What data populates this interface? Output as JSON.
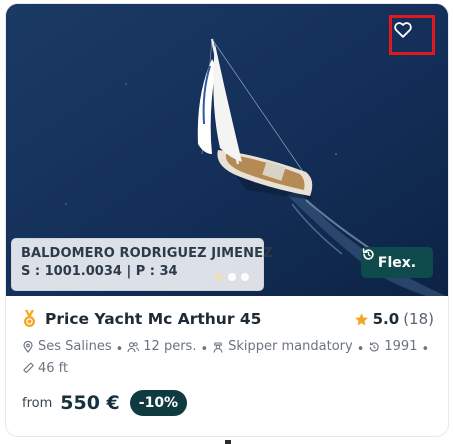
{
  "listing": {
    "owner_name": "BALDOMERO RODRIGUEZ JIMENEZ",
    "owner_meta": "S : 1001.0034 | P : 34",
    "flex_label": "Flex.",
    "title": "Price Yacht Mc Arthur 45",
    "rating_value": "5.0",
    "rating_count": "(18)",
    "specs": {
      "location": "Ses Salines",
      "capacity": "12 pers.",
      "skipper": "Skipper mandatory",
      "year": "1991",
      "length": "46 ft"
    },
    "price_prefix": "from",
    "price": "550 €",
    "discount": "-10%",
    "carousel_dots_count": 3,
    "carousel_active_index": 0
  },
  "icons": {
    "favorite": "heart-icon",
    "flex": "refresh-icon",
    "award": "medal-icon",
    "rating": "star-icon",
    "location": "location-pin-icon",
    "capacity": "people-icon",
    "skipper": "skipper-icon",
    "year": "history-icon",
    "length": "ruler-icon"
  },
  "colors": {
    "accent_dark_teal": "#0f4a4c",
    "discount_bg": "#0f3b40",
    "highlight_red": "#e0191e",
    "star_gold": "#f5a623"
  }
}
